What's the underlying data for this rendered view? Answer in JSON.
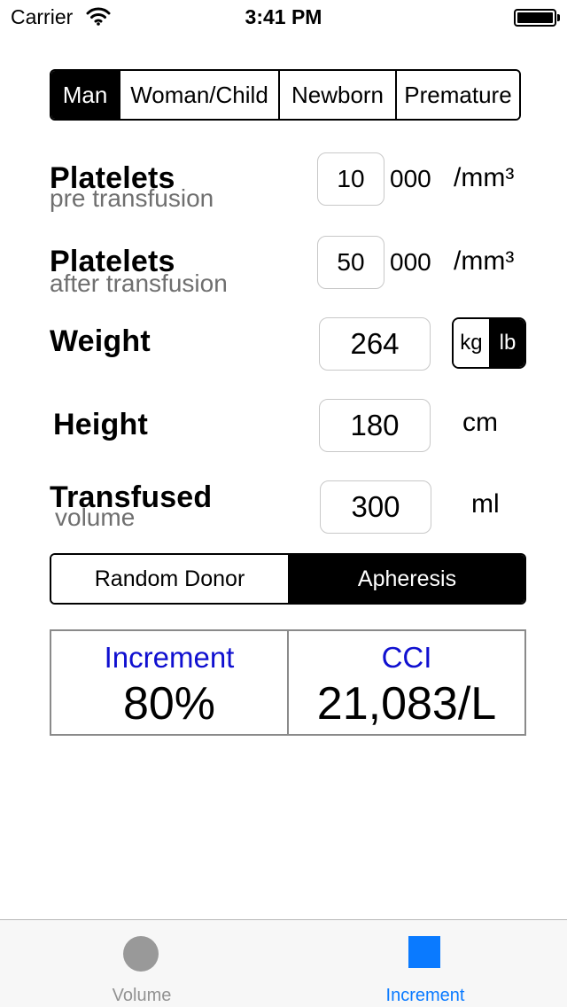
{
  "status_bar": {
    "carrier": "Carrier",
    "time": "3:41 PM"
  },
  "patient_type": {
    "options": [
      "Man",
      "Woman/Child",
      "Newborn",
      "Premature"
    ],
    "selected": "Man"
  },
  "platelets_pre": {
    "label": "Platelets",
    "sublabel": "pre transfusion",
    "value": "10",
    "suffix": "000",
    "unit": "/mm³"
  },
  "platelets_post": {
    "label": "Platelets",
    "sublabel": "after transfusion",
    "value": "50",
    "suffix": "000",
    "unit": "/mm³"
  },
  "weight": {
    "label": "Weight",
    "value": "264",
    "units": [
      "kg",
      "lb"
    ],
    "selected_unit": "lb"
  },
  "height": {
    "label": "Height",
    "value": "180",
    "unit": "cm"
  },
  "transfused": {
    "label": "Transfused",
    "sublabel": "volume",
    "value": "300",
    "unit": "ml"
  },
  "donor_type": {
    "options": [
      "Random Donor",
      "Apheresis"
    ],
    "selected": "Apheresis"
  },
  "results": {
    "increment": {
      "title": "Increment",
      "value": "80%"
    },
    "cci": {
      "title": "CCI",
      "value": "21,083/L"
    }
  },
  "tab_bar": {
    "tabs": [
      {
        "label": "Volume",
        "icon": "circle-icon",
        "active": false
      },
      {
        "label": "Increment",
        "icon": "square-icon",
        "active": true
      }
    ],
    "active_color": "#0a7aff",
    "inactive_color": "#929292"
  },
  "colors": {
    "result_title": "#1010d0",
    "accent": "#0a7aff"
  }
}
